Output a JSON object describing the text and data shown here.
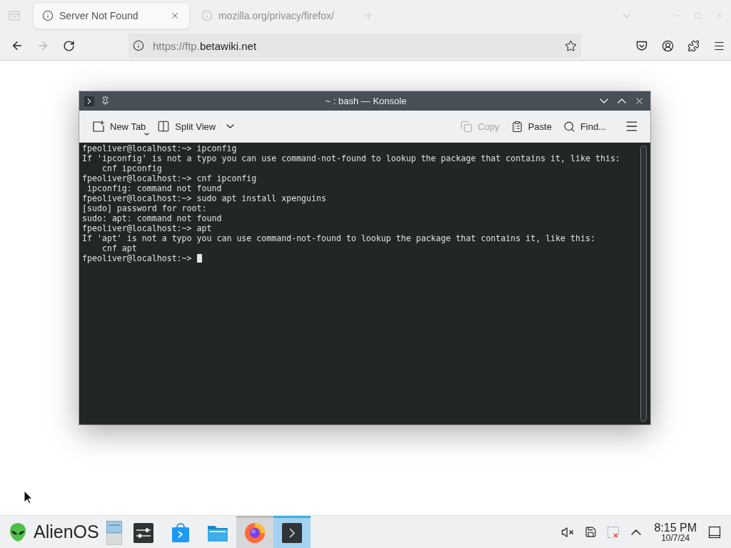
{
  "browser": {
    "tabs": [
      {
        "title": "Server Not Found",
        "selected": true
      },
      {
        "title": "mozilla.org/privacy/firefox/",
        "selected": false
      }
    ],
    "nav_buttons": [
      {
        "kind": "back",
        "disabled": false
      },
      {
        "kind": "forward",
        "disabled": true
      },
      {
        "kind": "reload",
        "disabled": false
      }
    ],
    "address_bar": {
      "url_prefix": "https://ftp.",
      "url_domain": "betawiki.net"
    }
  },
  "konsole": {
    "title": "~ : bash — Konsole",
    "toolbar": {
      "left": [
        {
          "kind": "new-tab",
          "label": "New Tab",
          "disabled": false
        },
        {
          "kind": "split-view",
          "label": "Split View",
          "disabled": false
        }
      ],
      "right": [
        {
          "kind": "copy",
          "label": "Copy",
          "disabled": true
        },
        {
          "kind": "paste",
          "label": "Paste",
          "disabled": false
        },
        {
          "kind": "find",
          "label": "Find...",
          "disabled": false
        }
      ]
    },
    "terminal": {
      "lines": [
        "fpeoliver@localhost:~> ipconfig",
        "If 'ipconfig' is not a typo you can use command-not-found to lookup the package that contains it, like this:",
        "    cnf ipconfig",
        "fpeoliver@localhost:~> cnf ipconfig",
        " ipconfig: command not found",
        "fpeoliver@localhost:~> sudo apt install xpenguins",
        "[sudo] password for root:",
        "sudo: apt: command not found",
        "fpeoliver@localhost:~> apt",
        "If 'apt' is not a typo you can use command-not-found to lookup the package that contains it, like this:",
        "    cnf apt",
        "fpeoliver@localhost:~>"
      ],
      "cursor": true
    }
  },
  "taskbar": {
    "launcher": {
      "label": "AlienOS"
    },
    "tasks": [
      {
        "kind": "pager",
        "open": false,
        "selected": false
      },
      {
        "kind": "settings",
        "open": false,
        "selected": false
      },
      {
        "kind": "store",
        "open": false,
        "selected": false
      },
      {
        "kind": "files",
        "open": false,
        "selected": false
      },
      {
        "kind": "browser",
        "open": true,
        "selected": false
      },
      {
        "kind": "terminal",
        "open": true,
        "selected": true
      }
    ],
    "clock": {
      "time": "8:15 PM",
      "date": "10/7/24"
    }
  }
}
